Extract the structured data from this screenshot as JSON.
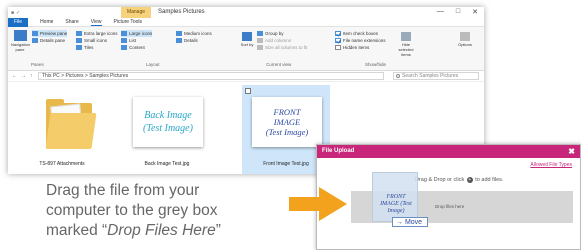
{
  "window": {
    "title": "Samples Pictures",
    "manage_tab": "Manage",
    "controls": [
      "—",
      "□",
      "✕"
    ]
  },
  "menu": {
    "file": "File",
    "home": "Home",
    "share": "Share",
    "view": "View",
    "picture_tools": "Picture Tools"
  },
  "ribbon": {
    "navigation_pane": "Navigation pane",
    "preview_pane": "Preview pane",
    "details_pane": "Details pane",
    "panes_label": "Panes",
    "extra_large_icons": "Extra large icons",
    "large_icons": "Large icons",
    "medium_icons": "Medium icons",
    "small_icons": "Small icons",
    "list": "List",
    "details": "Details",
    "tiles": "Tiles",
    "content": "Content",
    "layout_label": "Layout",
    "sort_by": "Sort by",
    "group_by": "Group by",
    "add_columns": "Add columns",
    "size_all_columns": "Size all columns to fit",
    "current_view_label": "Current view",
    "item_check_boxes": "Item check boxes",
    "file_name_extensions": "File name extensions",
    "hidden_items": "Hidden items",
    "hide_selected_items": "Hide selected items",
    "options": "Options",
    "show_hide_label": "Show/hide"
  },
  "address": {
    "path": "This PC  >  Pictures  >  Samples Pictures",
    "search_placeholder": "Search Samples Pictures"
  },
  "files": [
    {
      "name": "TS-897 Attachments"
    },
    {
      "name": "Back Image Test.jpg",
      "thumb_line1": "Back Image",
      "thumb_line2": "(Test Image)"
    },
    {
      "name": "Front Image Test.jpg",
      "thumb_line1": "FRONT",
      "thumb_line2": "IMAGE",
      "thumb_line3": "(Test Image)"
    }
  ],
  "instruction": {
    "line1": "Drag the file from your",
    "line2": "computer to the grey box",
    "line3_prefix": "marked “",
    "line3_em": "Drop Files Here",
    "line3_suffix": "”"
  },
  "dialog": {
    "title": "File Upload",
    "close": "✖",
    "link": "Allowed File Types",
    "hint_prefix": "Drag & Drop or click",
    "hint_suffix": "to add files.",
    "drop_label": "Drop files here",
    "drag_text": "FRONT IMAGE (Test Image)",
    "move": "Move"
  },
  "colors": {
    "accent": "#1a6fc4",
    "dialog_header": "#c8267a",
    "arrow": "#f2a21c",
    "dropzone": "#d6d6d6"
  }
}
